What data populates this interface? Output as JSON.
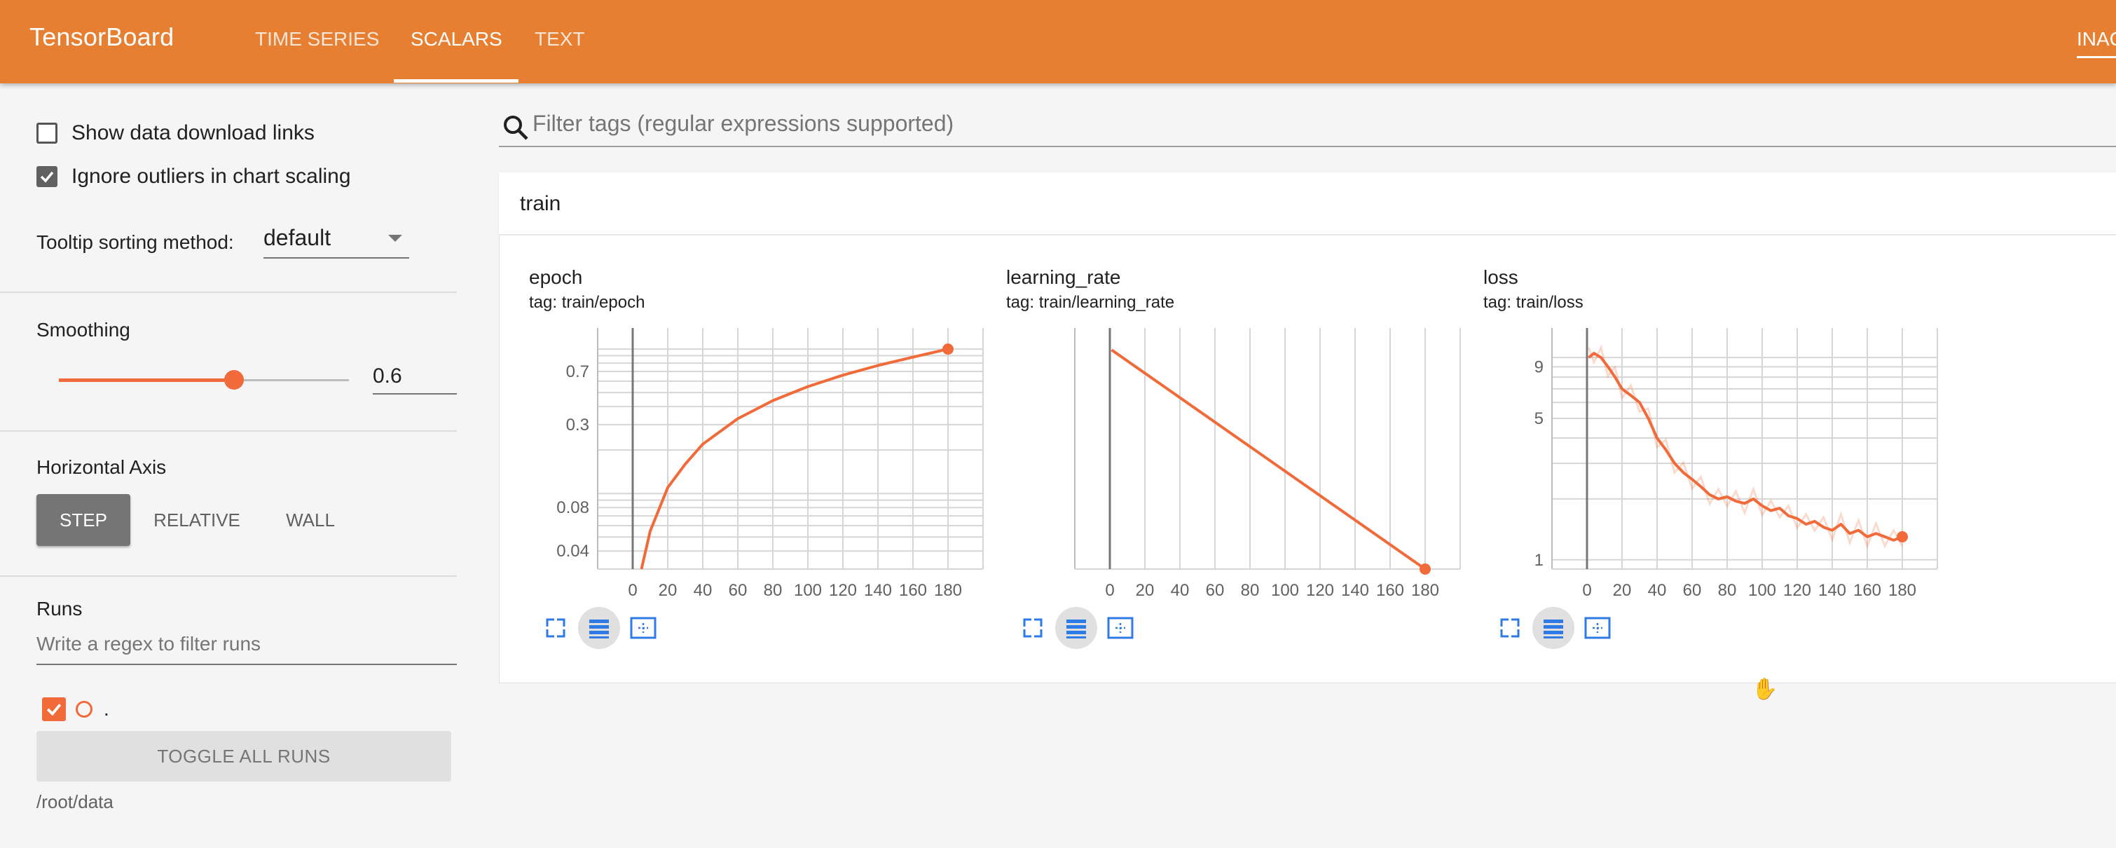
{
  "app": {
    "brand": "TensorBoard",
    "inactive_label": "INACTIVE"
  },
  "nav": {
    "tabs": [
      {
        "label": "TIME SERIES"
      },
      {
        "label": "SCALARS"
      },
      {
        "label": "TEXT"
      }
    ],
    "active": "SCALARS"
  },
  "sidebar": {
    "show_download_links": {
      "label": "Show data download links",
      "checked": false
    },
    "ignore_outliers": {
      "label": "Ignore outliers in chart scaling",
      "checked": true
    },
    "tooltip_sort": {
      "label": "Tooltip sorting method:",
      "value": "default"
    },
    "smoothing": {
      "title": "Smoothing",
      "value": "0.6",
      "fraction": 0.6
    },
    "horizontal_axis": {
      "title": "Horizontal Axis",
      "options": [
        "STEP",
        "RELATIVE",
        "WALL"
      ],
      "selected": "STEP"
    },
    "runs": {
      "title": "Runs",
      "filter_placeholder": "Write a regex to filter runs",
      "run_name": ".",
      "toggle_label": "TOGGLE ALL RUNS",
      "path": "/root/data"
    }
  },
  "main": {
    "filter_placeholder": "Filter tags (regular expressions supported)",
    "group_title": "train"
  },
  "colors": {
    "accent": "#e67f32",
    "series": "#f06a3a"
  },
  "icons": [
    "search-icon",
    "fullscreen-icon",
    "log-scale-icon",
    "fit-domain-icon",
    "check-icon",
    "hand-cursor-icon"
  ],
  "chart_data": [
    {
      "type": "line",
      "title": "epoch",
      "subtitle": "tag: train/epoch",
      "yscale": "log",
      "ylim": [
        0.03,
        1.4
      ],
      "xlim": [
        -20,
        200
      ],
      "x_ticks": [
        0,
        20,
        40,
        60,
        80,
        100,
        120,
        140,
        160,
        180
      ],
      "y_ticks": [
        0.04,
        0.08,
        0.3,
        0.7
      ],
      "series": [
        {
          "values_x": [
            5,
            10,
            20,
            30,
            40,
            60,
            80,
            100,
            120,
            140,
            160,
            180
          ],
          "values_y": [
            0.03,
            0.055,
            0.11,
            0.16,
            0.22,
            0.33,
            0.44,
            0.55,
            0.66,
            0.77,
            0.88,
            1.0
          ]
        }
      ]
    },
    {
      "type": "line",
      "title": "learning_rate",
      "subtitle": "tag: train/learning_rate",
      "yscale": "linear",
      "ylim": [
        0,
        1.1
      ],
      "xlim": [
        -20,
        200
      ],
      "x_ticks": [
        0,
        20,
        40,
        60,
        80,
        100,
        120,
        140,
        160,
        180
      ],
      "y_ticks": [],
      "series": [
        {
          "values_x": [
            1,
            180
          ],
          "values_y": [
            1.0,
            0.0
          ]
        }
      ]
    },
    {
      "type": "line",
      "title": "loss",
      "subtitle": "tag: train/loss",
      "yscale": "log",
      "ylim": [
        0.9,
        14
      ],
      "xlim": [
        -20,
        200
      ],
      "x_ticks": [
        0,
        20,
        40,
        60,
        80,
        100,
        120,
        140,
        160,
        180
      ],
      "y_ticks": [
        1,
        5,
        9
      ],
      "series": [
        {
          "values_x": [
            1,
            4,
            8,
            12,
            16,
            20,
            25,
            30,
            35,
            40,
            45,
            50,
            55,
            60,
            65,
            70,
            75,
            80,
            85,
            90,
            95,
            100,
            105,
            110,
            115,
            120,
            125,
            130,
            135,
            140,
            145,
            150,
            155,
            160,
            165,
            170,
            175,
            180
          ],
          "values_y": [
            10,
            10.5,
            10,
            9,
            8,
            7,
            6.5,
            6,
            5,
            4,
            3.5,
            3,
            2.7,
            2.5,
            2.3,
            2.1,
            2.0,
            2.05,
            1.95,
            1.9,
            2.0,
            1.85,
            1.75,
            1.8,
            1.65,
            1.6,
            1.5,
            1.55,
            1.45,
            1.4,
            1.5,
            1.35,
            1.4,
            1.3,
            1.35,
            1.3,
            1.25,
            1.3
          ]
        }
      ]
    }
  ]
}
